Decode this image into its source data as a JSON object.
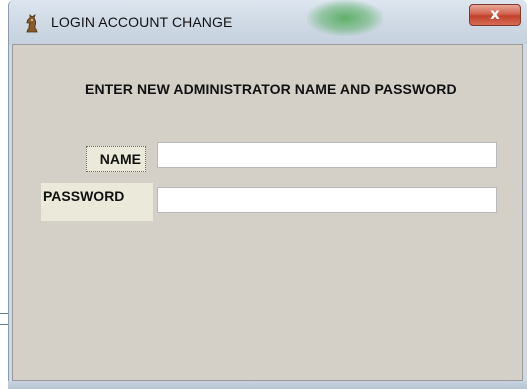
{
  "window": {
    "title": "LOGIN ACCOUNT CHANGE",
    "close_label": "x"
  },
  "form": {
    "heading": "ENTER NEW ADMINISTRATOR NAME AND PASSWORD",
    "name_label": "NAME",
    "name_value": "",
    "password_label": "PASSWORD",
    "password_value": ""
  },
  "colors": {
    "client_background": "#d4d0c8",
    "label_background": "#ebe9da",
    "close_button": "#c2432c",
    "title_bar": "#cdd8e4"
  },
  "icons": {
    "app_icon": "chess-knight-icon",
    "close_icon": "close-icon"
  }
}
